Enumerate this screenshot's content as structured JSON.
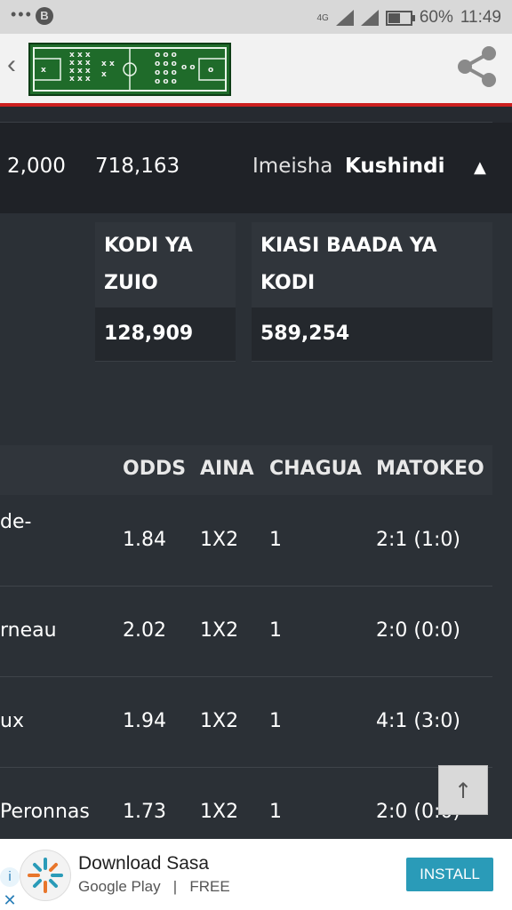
{
  "status_bar": {
    "network": "4G",
    "battery": "60%",
    "time": "11:49",
    "app_badge": "B"
  },
  "app_header": {
    "back_glyph": "‹"
  },
  "summary": {
    "stake": "2,000",
    "win": "718,163",
    "status": "Imeisha",
    "result": "Kushindi",
    "toggle_glyph": "▲"
  },
  "kodi": {
    "withheld_header": "KODI YA ZUIO",
    "withheld_value": "128,909",
    "after_tax_header": "KIASI BAADA YA KODI",
    "after_tax_value": "589,254"
  },
  "table": {
    "headers": {
      "odds": "ODDS",
      "aina": "AINA",
      "chagua": "CHAGUA",
      "matokeo": "MATOKEO"
    },
    "rows": [
      {
        "match": "de-",
        "odds": "1.84",
        "aina": "1X2",
        "chagua": "1",
        "matokeo": "2:1 (1:0)"
      },
      {
        "match": "rneau",
        "odds": "2.02",
        "aina": "1X2",
        "chagua": "1",
        "matokeo": "2:0 (0:0)"
      },
      {
        "match": "ux",
        "odds": "1.94",
        "aina": "1X2",
        "chagua": "1",
        "matokeo": "4:1 (3:0)"
      },
      {
        "match": "Peronnas",
        "odds": "1.73",
        "aina": "1X2",
        "chagua": "1",
        "matokeo": "2:0 (0:0)"
      }
    ]
  },
  "scroll_top_glyph": "↑",
  "ad": {
    "title": "Download Sasa",
    "store": "Google Play",
    "separator": "|",
    "price": "FREE",
    "install": "INSTALL",
    "info_glyph": "i",
    "close_glyph": "✕"
  }
}
